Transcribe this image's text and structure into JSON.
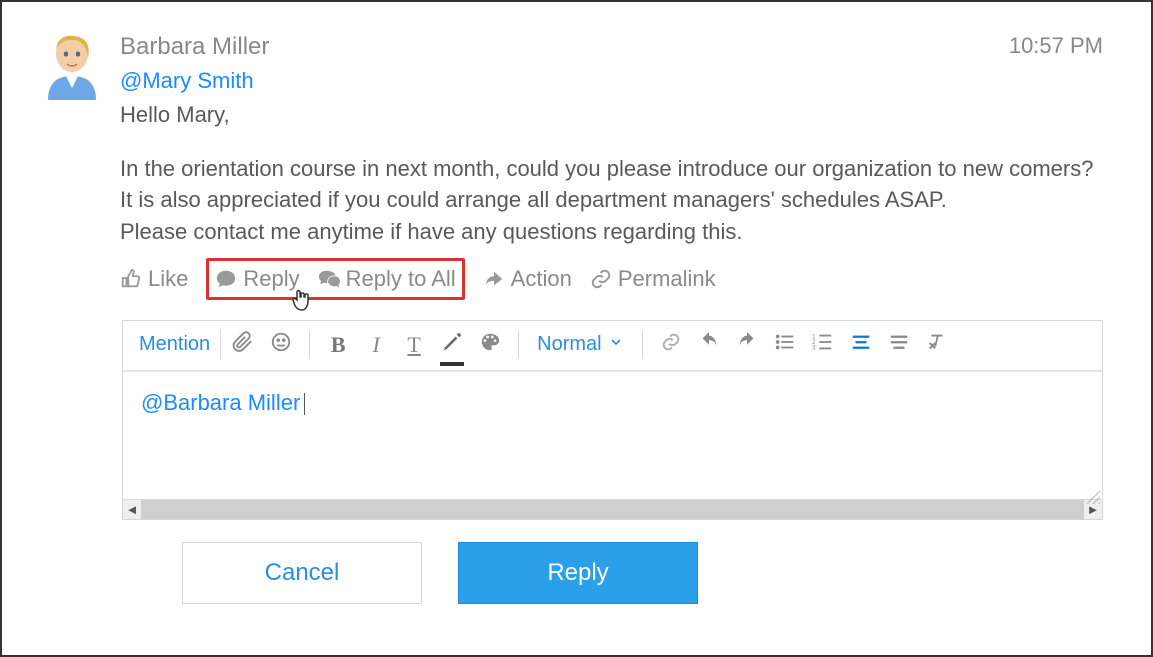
{
  "post": {
    "author": "Barbara Miller",
    "timestamp": "10:57 PM",
    "mention": "@Mary Smith",
    "body_line1": "Hello Mary,",
    "body_line2": "In the orientation course in next month, could you please introduce our organization to new comers?",
    "body_line3": "It is also appreciated if you could arrange all department managers' schedules ASAP.",
    "body_line4": "Please contact me anytime if have any questions regarding this."
  },
  "actions": {
    "like": "Like",
    "reply": "Reply",
    "reply_all": "Reply to All",
    "action": "Action",
    "permalink": "Permalink"
  },
  "toolbar": {
    "mention": "Mention",
    "bold": "B",
    "italic": "I",
    "underline": "T",
    "format": "Normal"
  },
  "editor": {
    "mention": "@Barbara Miller"
  },
  "buttons": {
    "cancel": "Cancel",
    "reply": "Reply"
  }
}
